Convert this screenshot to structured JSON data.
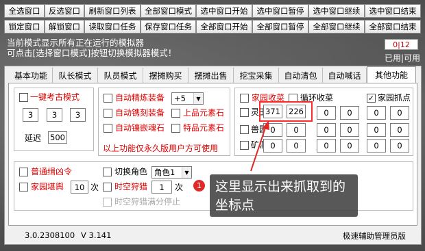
{
  "toolbar": {
    "row1": [
      "全选窗口",
      "反选窗口",
      "刷新窗口列表",
      "全部窗口模式",
      "选中窗口开始",
      "选中窗口暂停",
      "选中窗口继续",
      "选中窗口结束"
    ],
    "row2": [
      "锁定窗口",
      "解锁窗口",
      "读取窗口任务",
      "保存窗口任务",
      "全部窗口开始",
      "全部窗口暂停",
      "全部窗口继续",
      "全部窗口结束"
    ]
  },
  "info": {
    "line1": "当前模式显示所有正在运行的模拟器",
    "line2": "可点击[选择窗口模式]按钮切换模拟器模式！",
    "ratio": "0|12",
    "used": "已用|可用"
  },
  "tabs": [
    "基本功能",
    "队长模式",
    "队员模式",
    "摆摊购买",
    "摆摊出售",
    "挖宝采集",
    "自动清包",
    "自动喊话",
    "其他功能"
  ],
  "kaogu": {
    "label": "一键考古模式",
    "values": [
      "3",
      "3",
      "3"
    ],
    "delay_label": "延迟",
    "delay_value": "500"
  },
  "equip": {
    "jinglian_label": "自动精炼装备",
    "jinglian_select": "+5",
    "jianke_label": "自动镌刻装备",
    "shangpin_label": "上品元素石",
    "xiangqian_label": "自动镶嵌魂石",
    "tepin_label": "特品元素石",
    "vip_note": "以上功能仅永久版用户方可使用"
  },
  "home": {
    "jiayuan_shoucai": "家园收菜",
    "xunhuan_shoucai": "循环收菜",
    "jiayuan_zhuadian": "家园抓点",
    "rows": [
      {
        "label": "灵田",
        "values": [
          "371",
          "226",
          "0",
          "0",
          "0",
          "0"
        ]
      },
      {
        "label": "兽园",
        "values": [
          "0",
          "0",
          "0",
          "0",
          "0",
          "0"
        ]
      },
      {
        "label": "矿洞",
        "values": [
          "0",
          "0",
          "0",
          "0",
          "0",
          "0"
        ]
      }
    ]
  },
  "bottom": {
    "putong": "普通缉凶令",
    "jiayuan_kanyu": "家园堪舆",
    "kanyu_count": "10",
    "ci": "次",
    "qiehuan": "切换角色",
    "role_select": "角色1",
    "shikong": "时空狩猎",
    "shikong_count": "1",
    "ci2": "次",
    "shikong_stop": "时空狩猎满分停止"
  },
  "callout": {
    "badge": "1",
    "line1": "这里显示出来抓取到的",
    "line2": "坐标点"
  },
  "footer": {
    "version": "3.0.2308100",
    "v": "V 3.141",
    "brand": "极速辅助管理员版"
  },
  "colors": {
    "red_text": "#e00000",
    "highlight": "#ff2b2b",
    "badge": "#e02a2a"
  }
}
